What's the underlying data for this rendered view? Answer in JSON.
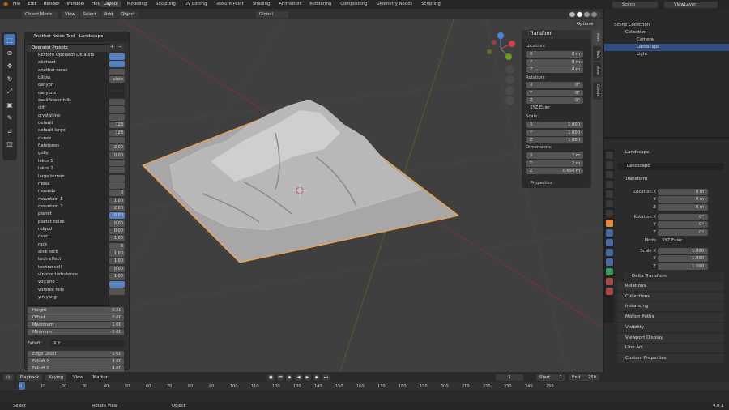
{
  "app_menu": [
    "File",
    "Edit",
    "Render",
    "Window",
    "Help"
  ],
  "workspace_tabs": [
    "Layout",
    "Modeling",
    "Sculpting",
    "UV Editing",
    "Texture Paint",
    "Shading",
    "Animation",
    "Rendering",
    "Compositing",
    "Geometry Nodes",
    "Scripting"
  ],
  "active_tab": "Layout",
  "scene": "Scene",
  "view_layer": "ViewLayer",
  "viewport": {
    "mode": "Object Mode",
    "menus": [
      "View",
      "Select",
      "Add",
      "Object"
    ],
    "transform_orientation": "Global",
    "options": "Options"
  },
  "operator": {
    "title": "Another Noise Tool - Landscape",
    "presets_title": "Operator Presets",
    "presets": [
      "Restore Operator Defaults",
      "abstract",
      "another noise",
      "billow",
      "canyon",
      "canyons",
      "cauliflower hills",
      "cliff",
      "crystalline",
      "default",
      "default large",
      "dunes",
      "flatstones",
      "gully",
      "lakes 1",
      "lakes 2",
      "large terrain",
      "mesa",
      "mounds",
      "mountain 1",
      "mountain 2",
      "planet",
      "planet noise",
      "ridged",
      "river",
      "rock",
      "slick rock",
      "tech effect",
      "techno cell",
      "vlnoise turbulence",
      "volcano",
      "voronoi hills",
      "yin yang"
    ],
    "right_values": [
      "",
      "",
      "",
      "ulate",
      "",
      "",
      "",
      "",
      "",
      "128",
      "128",
      "",
      "2.00",
      "0.00",
      "",
      "",
      "",
      "",
      "0",
      "1.00",
      "2.00",
      "0.00",
      "0.00",
      "0.00",
      "1.00",
      "8",
      "1.00",
      "1.00",
      "0.00",
      "1.00",
      "",
      ""
    ],
    "fields": [
      {
        "label": "Height",
        "value": "0.50"
      },
      {
        "label": "Offset",
        "value": "0.00"
      },
      {
        "label": "Maximum",
        "value": "1.00"
      },
      {
        "label": "Minimum",
        "value": "-1.00"
      }
    ],
    "falloff_label": "Falloff:",
    "falloff_value": "X Y",
    "falloff_fields": [
      {
        "label": "Edge Level",
        "value": "0.00"
      },
      {
        "label": "Falloff X",
        "value": "4.00"
      },
      {
        "label": "Falloff Y",
        "value": "4.00"
      }
    ]
  },
  "n_panel": {
    "title": "Transform",
    "location_label": "Location:",
    "location": [
      {
        "axis": "X",
        "value": "0 m"
      },
      {
        "axis": "Y",
        "value": "0 m"
      },
      {
        "axis": "Z",
        "value": "0 m"
      }
    ],
    "rotation_label": "Rotation:",
    "rotation": [
      {
        "axis": "X",
        "value": "0°"
      },
      {
        "axis": "Y",
        "value": "0°"
      },
      {
        "axis": "Z",
        "value": "0°"
      }
    ],
    "rotation_mode": "XYZ Euler",
    "scale_label": "Scale:",
    "scale": [
      {
        "axis": "X",
        "value": "1.000"
      },
      {
        "axis": "Y",
        "value": "1.000"
      },
      {
        "axis": "Z",
        "value": "1.000"
      }
    ],
    "dimensions_label": "Dimensions:",
    "dimensions": [
      {
        "axis": "X",
        "value": "2 m"
      },
      {
        "axis": "Y",
        "value": "2 m"
      },
      {
        "axis": "Z",
        "value": "0.654 m"
      }
    ],
    "properties": "Properties",
    "side_tabs": [
      "Item",
      "Tool",
      "View",
      "Create"
    ]
  },
  "outliner": {
    "rows": [
      {
        "label": "Scene Collection"
      },
      {
        "label": "Collection"
      },
      {
        "label": "Camera"
      },
      {
        "label": "Landscape"
      },
      {
        "label": "Light"
      }
    ]
  },
  "properties": {
    "object_name_header": "Landscape",
    "object_name": "Landscape",
    "transform_title": "Transform",
    "location_x_label": "Location X",
    "rotation_x_label": "Rotation X",
    "scale_x_label": "Scale X",
    "y_label": "Y",
    "z_label": "Z",
    "mode_label": "Mode",
    "location": [
      "0 m",
      "0 m",
      "0 m"
    ],
    "rotation": [
      "0°",
      "0°",
      "0°"
    ],
    "mode": "XYZ Euler",
    "scale": [
      "1.000",
      "1.000",
      "1.000"
    ],
    "delta": "Delta Transform",
    "sections": [
      "Relations",
      "Collections",
      "Instancing",
      "Motion Paths",
      "Visibility",
      "Viewport Display",
      "Line Art",
      "Custom Properties"
    ]
  },
  "timeline": {
    "playback": "Playback",
    "keying": "Keying",
    "view": "View",
    "marker": "Marker",
    "current_frame": "1",
    "start_label": "Start",
    "start": "1",
    "end_label": "End",
    "end": "250",
    "ticks": [
      "0",
      "10",
      "20",
      "30",
      "40",
      "50",
      "60",
      "70",
      "80",
      "90",
      "100",
      "110",
      "120",
      "130",
      "140",
      "150",
      "160",
      "170",
      "180",
      "190",
      "200",
      "210",
      "220",
      "230",
      "240",
      "250"
    ]
  },
  "status": {
    "select": "Select",
    "rotate": "Rotate View",
    "object": "Object",
    "version": "4.0.1"
  },
  "colors": {
    "accent": "#4772b3",
    "selection": "#f4a640",
    "terrain": "#bdbdbd"
  }
}
